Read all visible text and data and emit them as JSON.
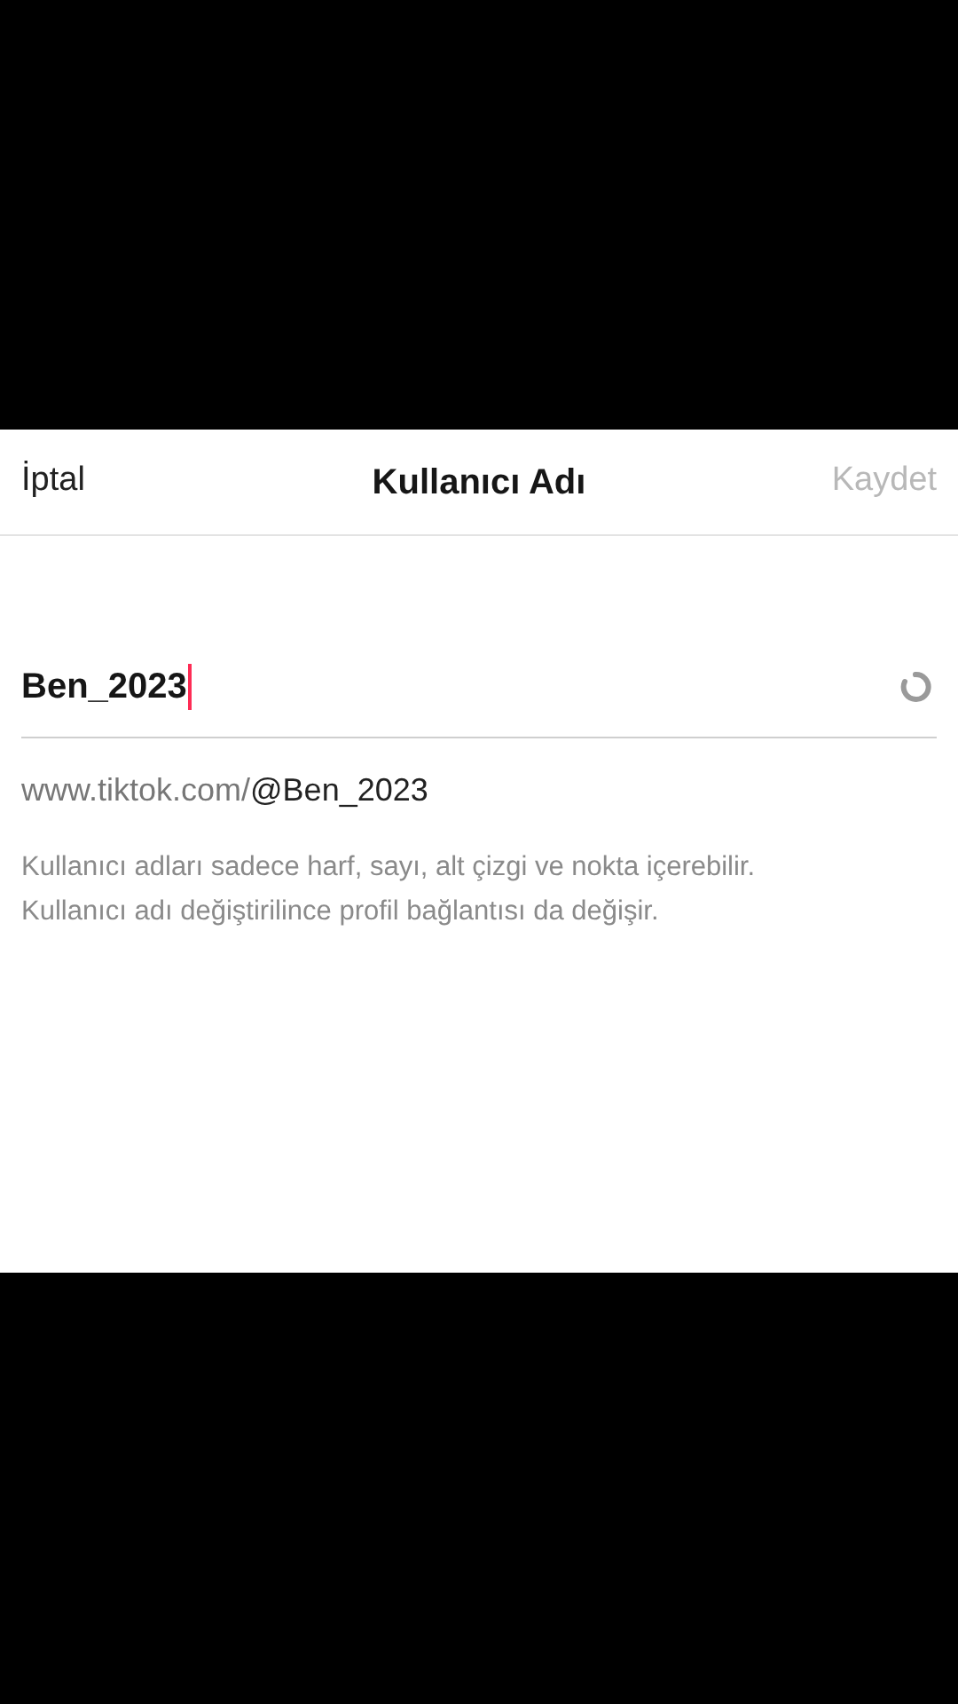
{
  "header": {
    "cancel": "İptal",
    "title": "Kullanıcı Adı",
    "save": {
      "label": "Kaydet",
      "disabled": true
    }
  },
  "username_field": {
    "value": "Ben_2023",
    "focused": true
  },
  "profile_url": {
    "prefix": "www.tiktok.com/",
    "handle": "@Ben_2023"
  },
  "help_lines": [
    "Kullanıcı adları sadece harf, sayı, alt çizgi ve nokta içerebilir.",
    "Kullanıcı adı değiştirilince profil bağlantısı da değişir."
  ]
}
